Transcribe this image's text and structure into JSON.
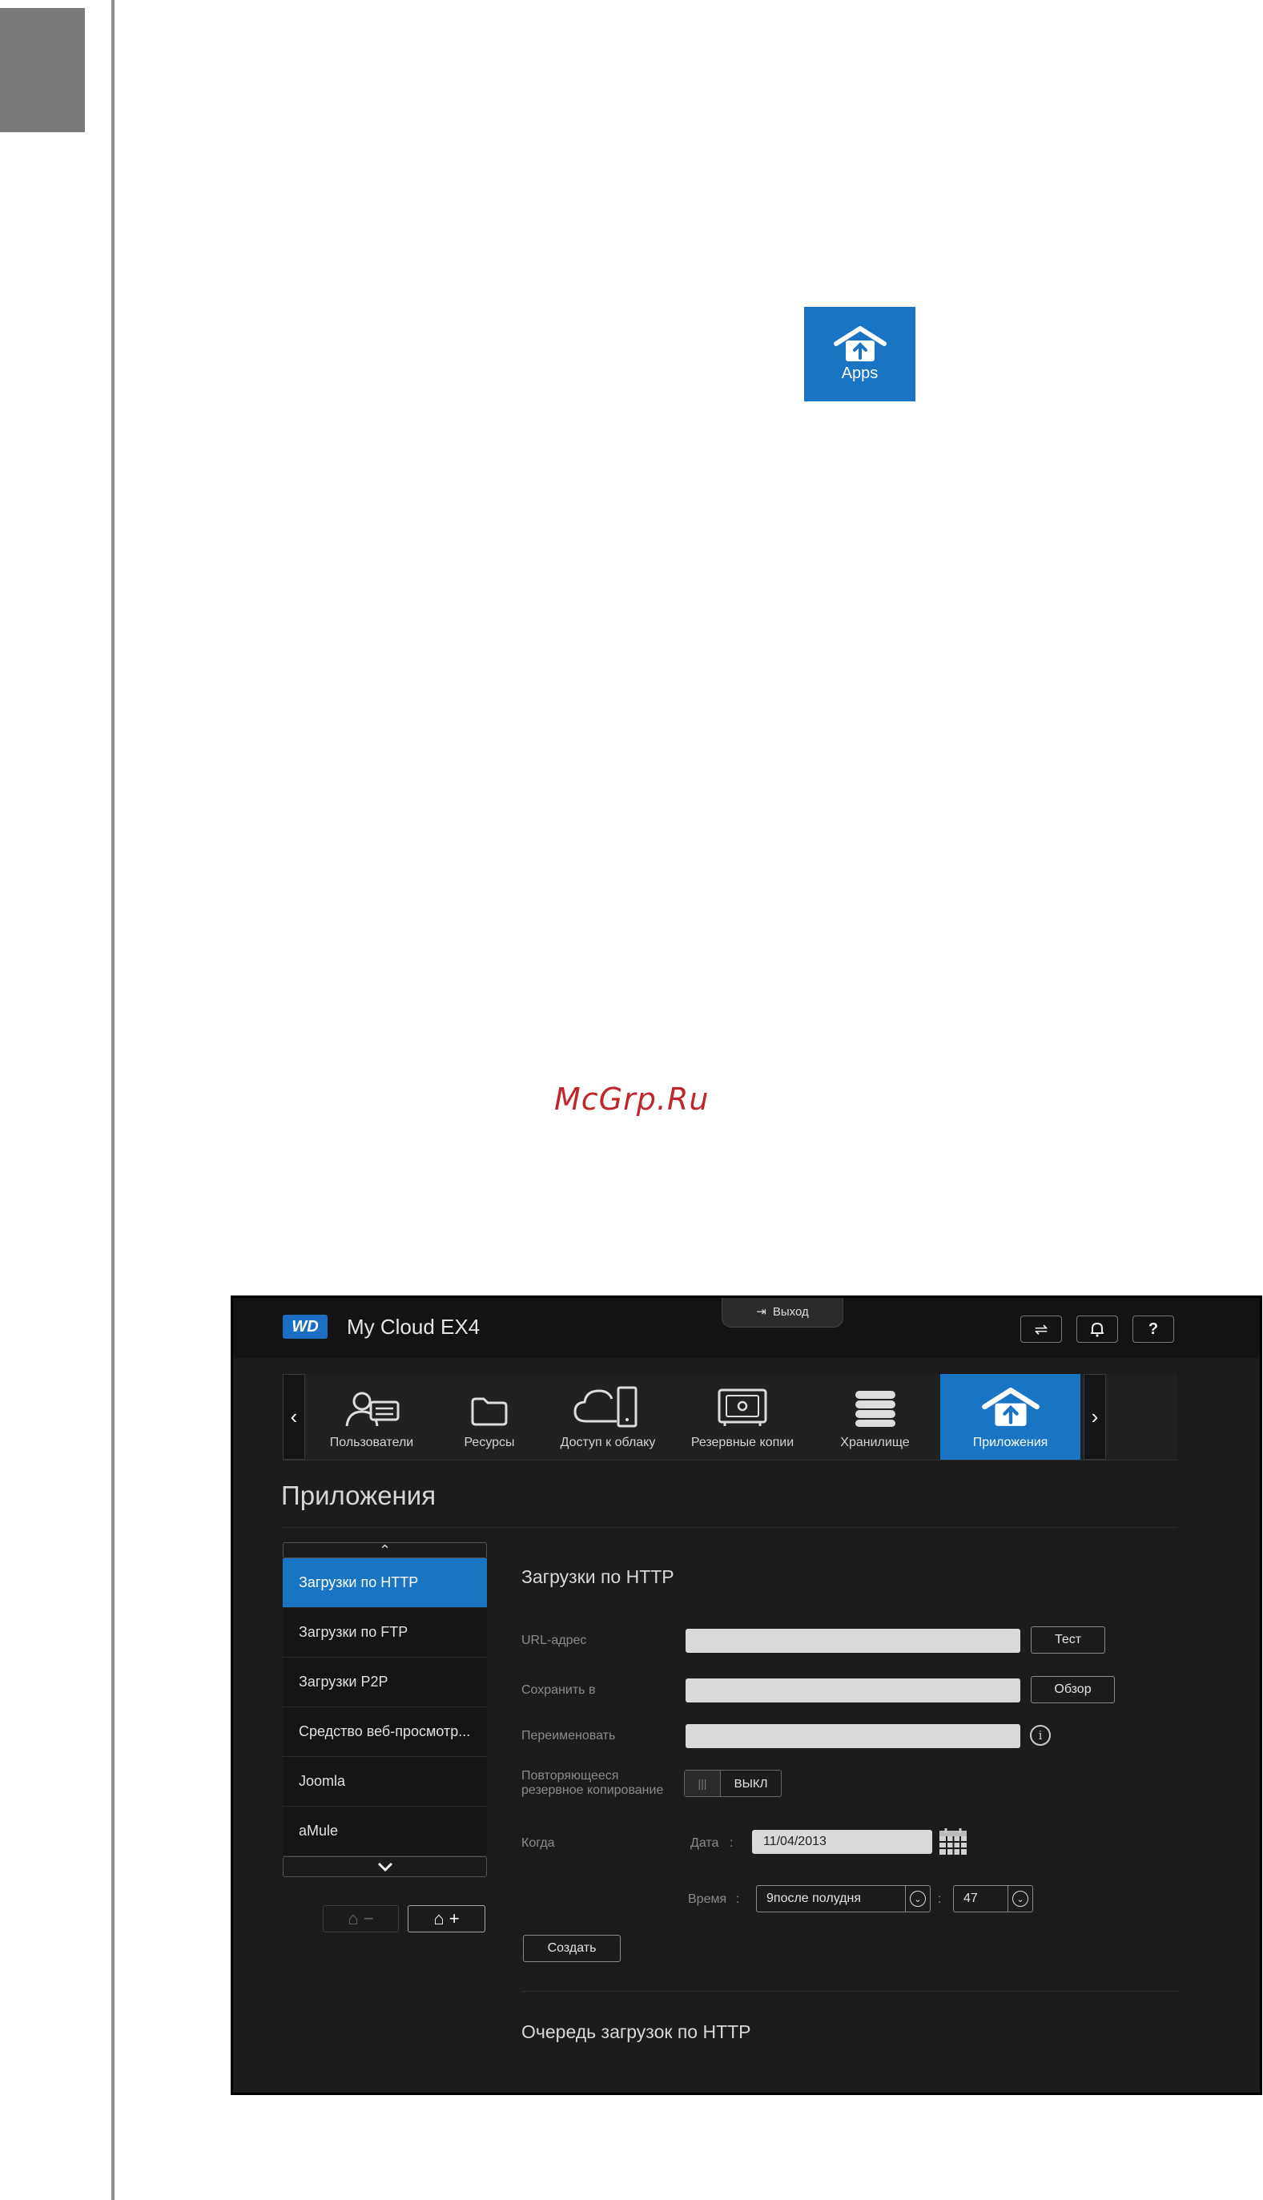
{
  "page": {
    "apps_badge_label": "Apps",
    "watermark": "McGrp.Ru"
  },
  "ui": {
    "logo": "WD",
    "product": "My Cloud EX4",
    "logout": "Выход",
    "top_icons": [
      "usb-icon",
      "bell-icon",
      "help-icon"
    ],
    "help_symbol": "?",
    "nav": {
      "prev": "‹",
      "next": "›",
      "items": [
        {
          "label": "Пользователи",
          "icon": "users-icon"
        },
        {
          "label": "Ресурсы",
          "icon": "folder-icon"
        },
        {
          "label": "Доступ к облаку",
          "icon": "cloud-icon"
        },
        {
          "label": "Резервные копии",
          "icon": "safe-icon"
        },
        {
          "label": "Хранилище",
          "icon": "storage-icon"
        },
        {
          "label": "Приложения",
          "icon": "apps-icon",
          "active": true
        }
      ]
    },
    "page_title": "Приложения",
    "app_list": {
      "items": [
        "Загрузки по HTTP",
        "Загрузки по FTP",
        "Загрузки P2P",
        "Средство веб-просмотр...",
        "Joomla",
        "aMule"
      ],
      "selected": "Загрузки по HTTP"
    },
    "form": {
      "heading": "Загрузки по HTTP",
      "url_label": "URL-адрес",
      "url_value": "",
      "test_button": "Тест",
      "save_label": "Сохранить в",
      "save_value": "",
      "browse_button": "Обзор",
      "rename_label": "Переименовать",
      "rename_value": "",
      "repeat_label_1": "Повторяющееся",
      "repeat_label_2": "резервное копирование",
      "toggle_grip": "|||",
      "toggle_state": "ВЫКЛ",
      "when_label": "Когда",
      "date_label": "Дата",
      "date_value": "11/04/2013",
      "time_label": "Время",
      "colon": ":",
      "hour_value": "9после полудня",
      "minute_value": "47",
      "create_button": "Создать"
    },
    "queue_heading": "Очередь загрузок по HTTP"
  }
}
